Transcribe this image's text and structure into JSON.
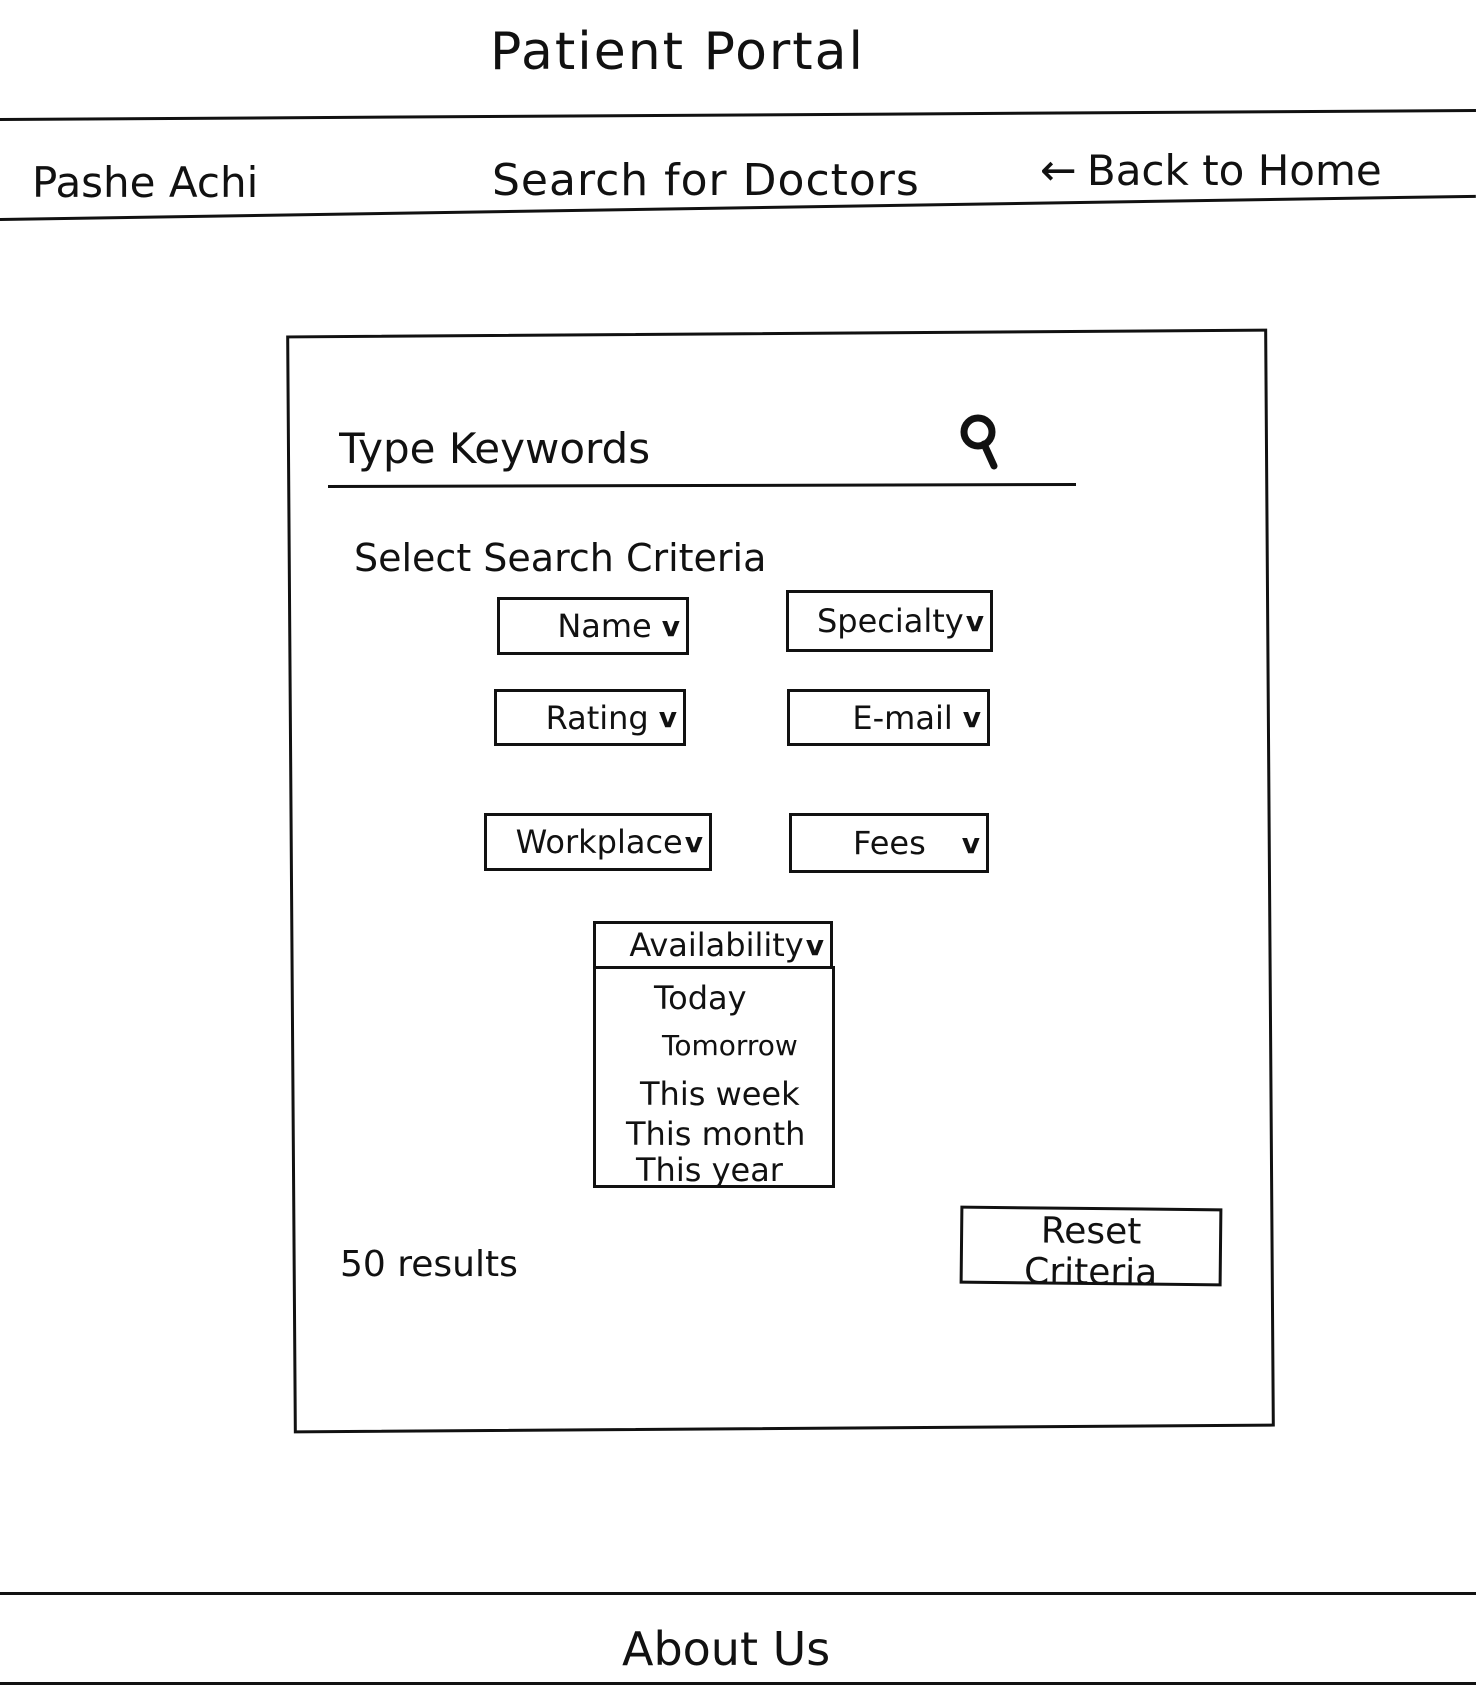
{
  "header": {
    "title": "Patient Portal",
    "user_name": "Pashe Achi",
    "page_heading": "Search for Doctors",
    "back_label": "Back to Home",
    "back_arrow": "←"
  },
  "search": {
    "placeholder": "Type Keywords",
    "value": "",
    "icon": "search-icon"
  },
  "criteria": {
    "heading": "Select Search Criteria",
    "chevron": "v",
    "filters": {
      "name": "Name",
      "specialty": "Specialty",
      "rating": "Rating",
      "email": "E-mail",
      "workplace": "Workplace",
      "fees": "Fees",
      "availability": "Availability"
    },
    "availability_options": [
      "Today",
      "Tomorrow",
      "This week",
      "This month",
      "This year"
    ]
  },
  "results": {
    "count_text": "50 results"
  },
  "actions": {
    "reset_label": "Reset Criteria"
  },
  "footer": {
    "about_label": "About Us"
  }
}
